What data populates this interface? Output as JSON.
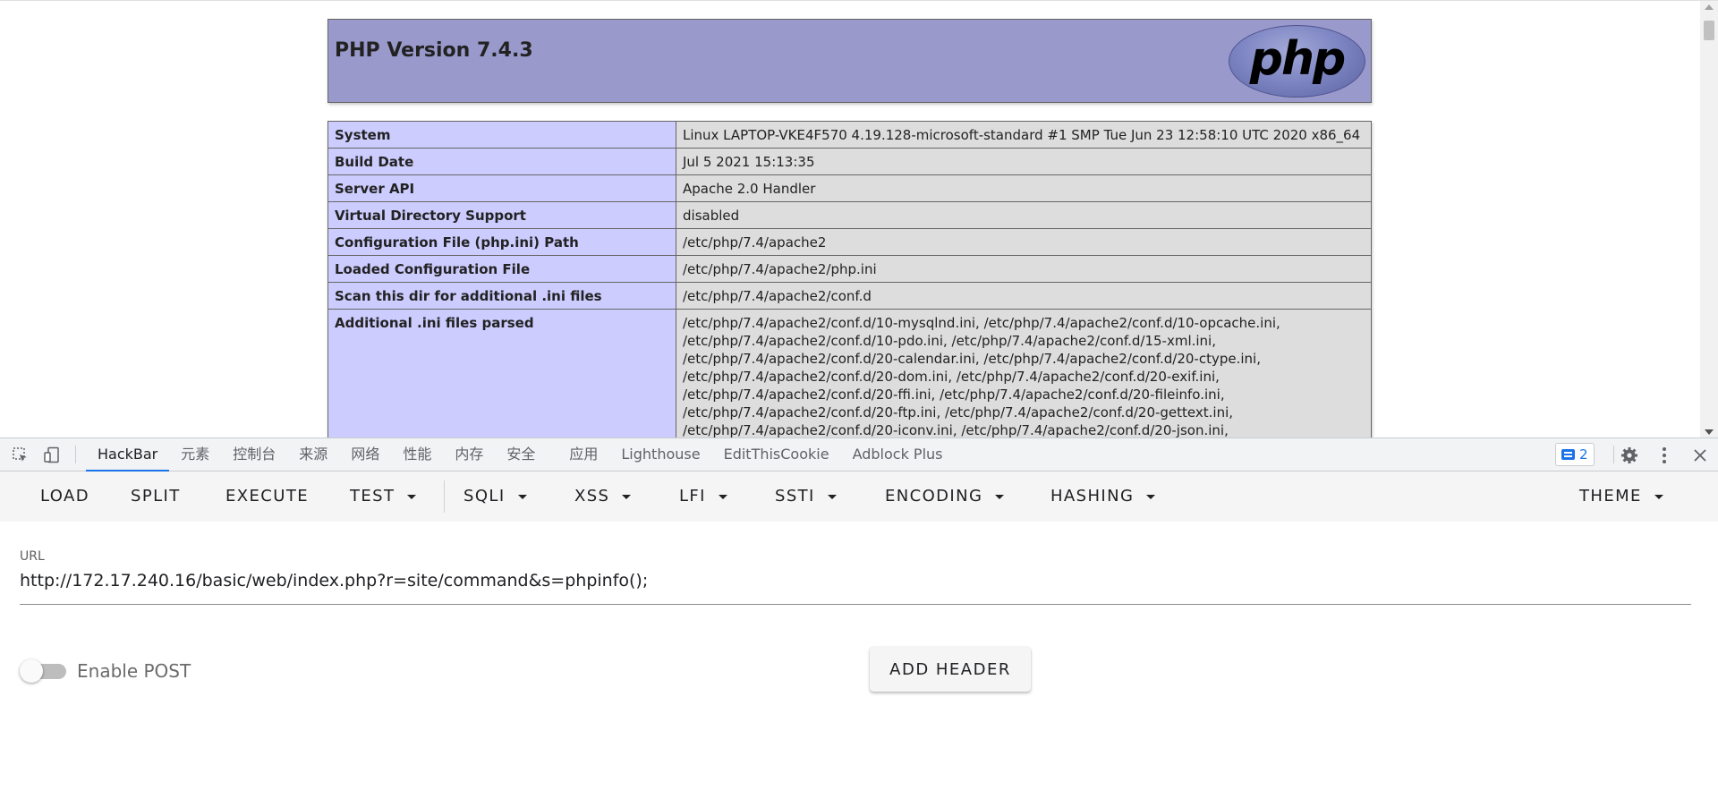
{
  "phpinfo": {
    "version_title": "PHP Version 7.4.3",
    "logo_text": "php",
    "rows": [
      {
        "key": "System",
        "value": "Linux LAPTOP-VKE4F570 4.19.128-microsoft-standard #1 SMP Tue Jun 23 12:58:10 UTC 2020 x86_64"
      },
      {
        "key": "Build Date",
        "value": "Jul 5 2021 15:13:35"
      },
      {
        "key": "Server API",
        "value": "Apache 2.0 Handler"
      },
      {
        "key": "Virtual Directory Support",
        "value": "disabled"
      },
      {
        "key": "Configuration File (php.ini) Path",
        "value": "/etc/php/7.4/apache2"
      },
      {
        "key": "Loaded Configuration File",
        "value": "/etc/php/7.4/apache2/php.ini"
      },
      {
        "key": "Scan this dir for additional .ini files",
        "value": "/etc/php/7.4/apache2/conf.d"
      },
      {
        "key": "Additional .ini files parsed",
        "value_lines": [
          "/etc/php/7.4/apache2/conf.d/10-mysqlnd.ini, /etc/php/7.4/apache2/conf.d/10-opcache.ini,",
          "/etc/php/7.4/apache2/conf.d/10-pdo.ini, /etc/php/7.4/apache2/conf.d/15-xml.ini,",
          "/etc/php/7.4/apache2/conf.d/20-calendar.ini, /etc/php/7.4/apache2/conf.d/20-ctype.ini,",
          "/etc/php/7.4/apache2/conf.d/20-dom.ini, /etc/php/7.4/apache2/conf.d/20-exif.ini,",
          "/etc/php/7.4/apache2/conf.d/20-ffi.ini, /etc/php/7.4/apache2/conf.d/20-fileinfo.ini,",
          "/etc/php/7.4/apache2/conf.d/20-ftp.ini, /etc/php/7.4/apache2/conf.d/20-gettext.ini,",
          "/etc/php/7.4/apache2/conf.d/20-iconv.ini, /etc/php/7.4/apache2/conf.d/20-json.ini,"
        ]
      }
    ]
  },
  "devtools": {
    "tabs": [
      {
        "label": "HackBar",
        "active": true
      },
      {
        "label": "元素"
      },
      {
        "label": "控制台"
      },
      {
        "label": "来源"
      },
      {
        "label": "网络"
      },
      {
        "label": "性能"
      },
      {
        "label": "内存"
      },
      {
        "label": "安全"
      },
      {
        "label": "应用"
      },
      {
        "label": "Lighthouse"
      },
      {
        "label": "EditThisCookie"
      },
      {
        "label": "Adblock Plus"
      }
    ],
    "issues_count": "2",
    "icons": {
      "inspect": "inspect-element-icon",
      "device": "device-toolbar-icon",
      "issues": "message-icon",
      "settings": "gear-icon",
      "more": "more-vert-icon",
      "close": "close-icon"
    },
    "accent_color": "#1a73e8"
  },
  "hackbar": {
    "toolbar": {
      "load": "LOAD",
      "split": "SPLIT",
      "execute": "EXECUTE",
      "test": "TEST",
      "sqli": "SQLI",
      "xss": "XSS",
      "lfi": "LFI",
      "ssti": "SSTI",
      "encoding": "ENCODING",
      "hashing": "HASHING",
      "theme": "THEME"
    },
    "url_label": "URL",
    "url_value": "http://172.17.240.16/basic/web/index.php?r=site/command&s=phpinfo();",
    "enable_post_label": "Enable POST",
    "enable_post_on": false,
    "add_header_label": "ADD HEADER"
  }
}
